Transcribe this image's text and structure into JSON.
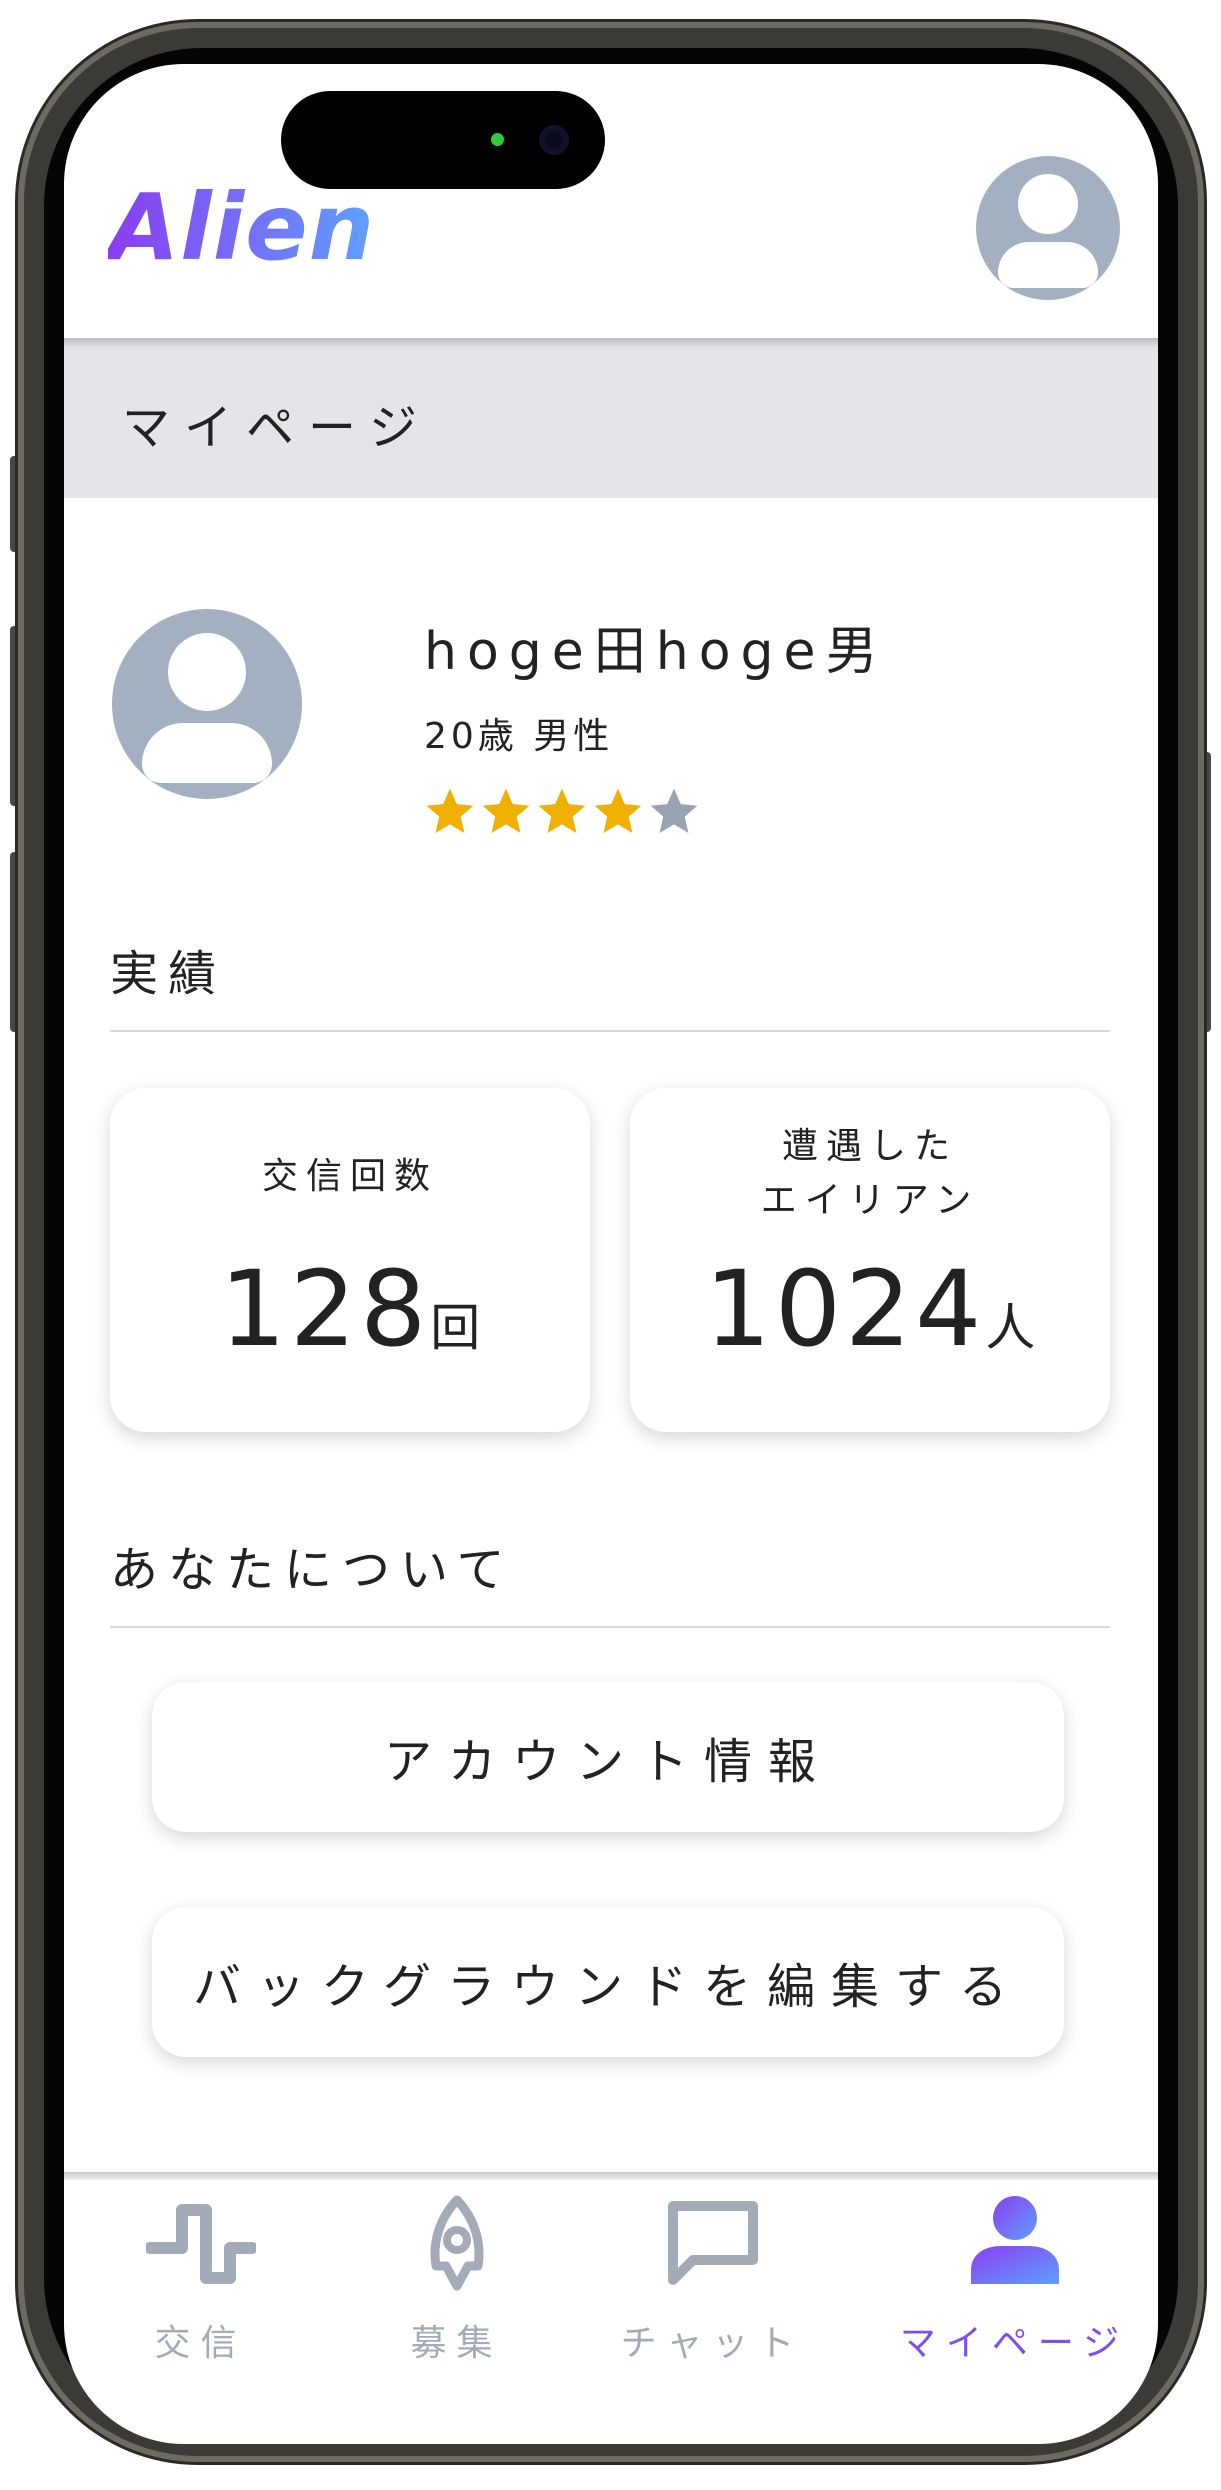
{
  "app": {
    "logo": "Alien"
  },
  "header": {
    "page_title": "マイページ"
  },
  "profile": {
    "name": "hoge田hoge男",
    "meta": "20歳 男性",
    "rating": 4,
    "rating_max": 5
  },
  "achievements": {
    "title": "実績",
    "cards": [
      {
        "label_lines": [
          "交信回数"
        ],
        "value": "128",
        "unit": "回"
      },
      {
        "label_lines": [
          "遭遇した",
          "エイリアン"
        ],
        "value": "1024",
        "unit": "人"
      }
    ]
  },
  "about": {
    "title": "あなたについて",
    "buttons": [
      "アカウント情報",
      "バックグラウンドを編集する"
    ]
  },
  "tabs": [
    {
      "label": "交信",
      "icon": "pulse-icon",
      "active": false
    },
    {
      "label": "募集",
      "icon": "rocket-icon",
      "active": false
    },
    {
      "label": "チャット",
      "icon": "chat-bubble-icon",
      "active": false
    },
    {
      "label": "マイページ",
      "icon": "person-icon",
      "active": true
    }
  ],
  "colors": {
    "accent": "#7d4ef2",
    "star_filled": "#f0b000",
    "star_empty": "#9aa3b2",
    "avatar_bg": "#a3b0c1",
    "tab_inactive": "#a3abb8"
  }
}
